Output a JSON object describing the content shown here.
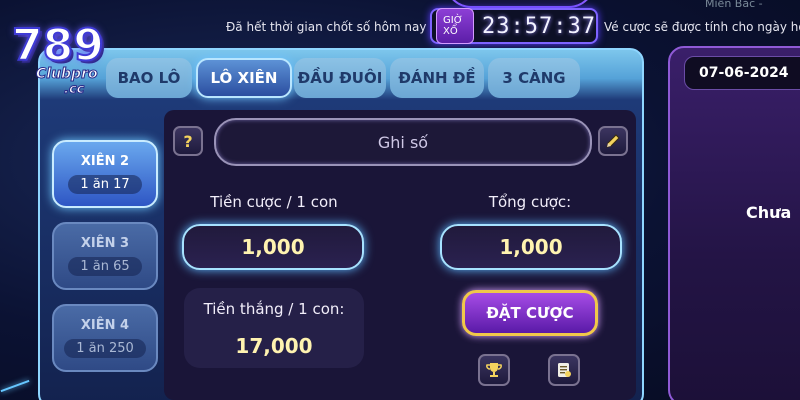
{
  "top": {
    "left_note": "Đã hết thời gian chốt số hôm nay",
    "draw_label": "GIỜ XỔ",
    "timer": "23:57:37",
    "right_note": "Vé cược sẽ được tính cho ngày hô",
    "corner_text": "Miền Bắc -"
  },
  "logo": {
    "number": "789",
    "sub": "Clubpro",
    "tld": ".cc"
  },
  "tabs": [
    {
      "label": "BAO LÔ",
      "active": false
    },
    {
      "label": "LÔ XIÊN",
      "active": true
    },
    {
      "label": "ĐẦU ĐUÔI",
      "active": false
    },
    {
      "label": "ĐÁNH ĐỀ",
      "active": false
    },
    {
      "label": "3 CÀNG",
      "active": false
    }
  ],
  "side": [
    {
      "title": "XIÊN 2",
      "rate": "1 ăn 17",
      "active": true
    },
    {
      "title": "XIÊN 3",
      "rate": "1 ăn 65",
      "active": false
    },
    {
      "title": "XIÊN 4",
      "rate": "1 ăn 250",
      "active": false
    }
  ],
  "form": {
    "help_symbol": "?",
    "number_placeholder": "Ghi số",
    "stake_label": "Tiền cược / 1 con",
    "stake_value": "1,000",
    "total_label": "Tổng cược:",
    "total_value": "1,000",
    "win_label": "Tiền thắng / 1 con:",
    "win_value": "17,000",
    "bet_button": "ĐẶT CƯỢC"
  },
  "icons": {
    "help": "question-icon",
    "edit": "pencil-icon",
    "trophy": "trophy-icon",
    "ticket": "ticket-icon"
  },
  "right": {
    "date": "07-06-2024",
    "status": "Chưa"
  },
  "colors": {
    "accent_blue": "#8fd6ff",
    "accent_purple": "#8f5ad6",
    "gold": "#f0c84a",
    "value_text": "#fff3b0"
  }
}
